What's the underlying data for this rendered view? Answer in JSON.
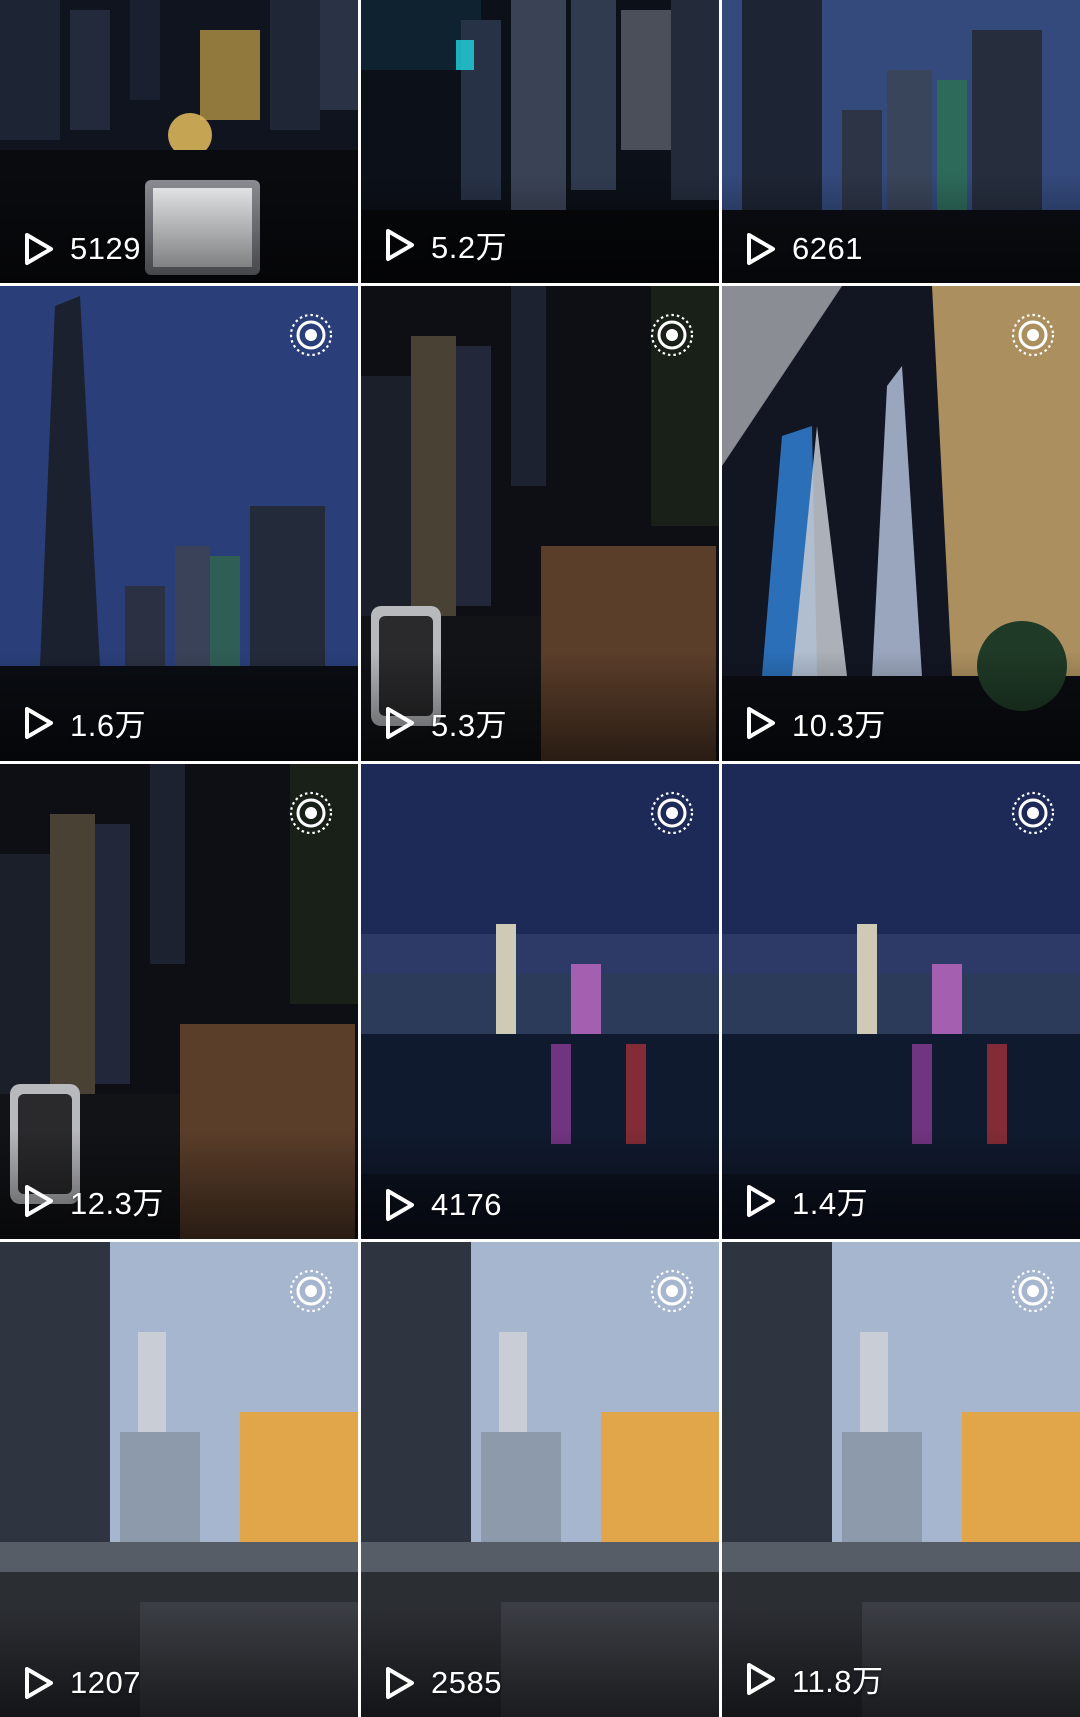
{
  "grid": {
    "tiles": [
      {
        "views": "5129",
        "scene": "night-harbor-view-with-tablet",
        "live": false
      },
      {
        "views": "5.2万",
        "scene": "aerial-night-skyline",
        "live": false
      },
      {
        "views": "6261",
        "scene": "dusk-skyscrapers",
        "live": false
      },
      {
        "views": "1.6万",
        "scene": "tall-tower-blue-dusk",
        "live": true
      },
      {
        "views": "5.3万",
        "scene": "night-street-aerial-with-phone",
        "live": true
      },
      {
        "views": "10.3万",
        "scene": "supertall-towers-night",
        "live": true
      },
      {
        "views": "12.3万",
        "scene": "night-street-aerial-with-phone",
        "live": true
      },
      {
        "views": "4176",
        "scene": "harbor-skyline-reflection",
        "live": true
      },
      {
        "views": "1.4万",
        "scene": "harbor-skyline-reflection",
        "live": true
      },
      {
        "views": "1207",
        "scene": "city-crossing-dusk",
        "live": true
      },
      {
        "views": "2585",
        "scene": "city-crossing-dusk",
        "live": true
      },
      {
        "views": "11.8万",
        "scene": "city-crossing-dusk",
        "live": true
      }
    ]
  },
  "icons": {
    "play": "play-outline-icon",
    "live": "live-photo-icon"
  },
  "colors": {
    "overlay_text": "#ffffff",
    "night_sky": "#0b1020",
    "dusk_sky": "#2a3f7a"
  }
}
